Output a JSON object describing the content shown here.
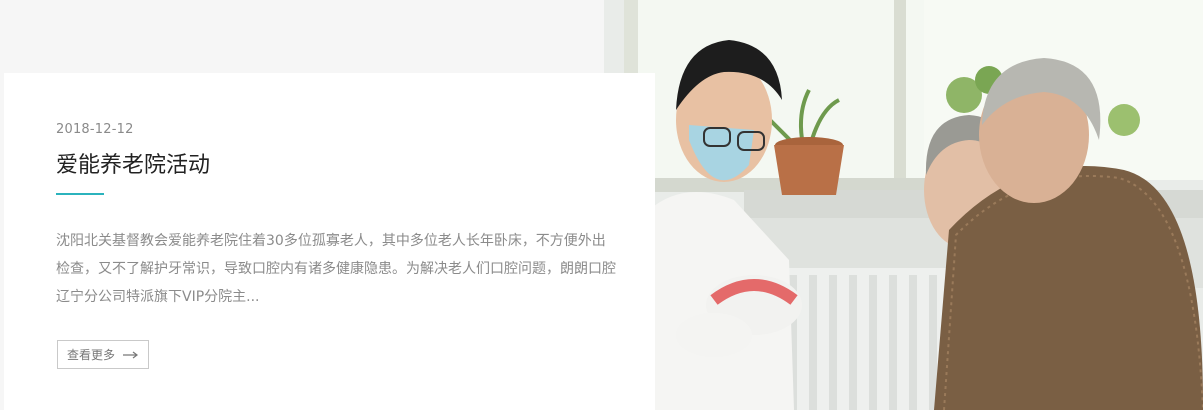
{
  "article": {
    "date": "2018-12-12",
    "title": "爱能养老院活动",
    "excerpt": "沈阳北关基督教会爱能养老院住着30多位孤寡老人，其中多位老人长年卧床，不方便外出检查，又不了解护牙常识，导致口腔内有诸多健康隐患。为解决老人们口腔问题，朗朗口腔辽宁分公司特派旗下VIP分院主...",
    "more_label": "查看更多"
  },
  "colors": {
    "accent": "#2bb3bd",
    "page_background": "#f6f6f6",
    "card_background": "#ffffff"
  },
  "icons": {
    "more_arrow": "arrow-right-icon"
  }
}
